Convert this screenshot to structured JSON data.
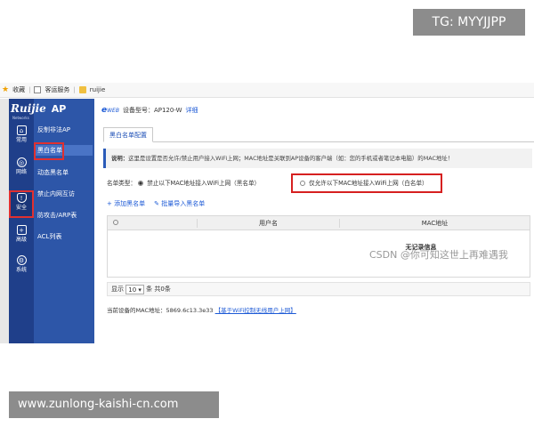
{
  "watermark_top": "TG: MYYJJPP",
  "watermark_bottom": "www.zunlong-kaishi-cn.com",
  "watermark_csdn": "CSDN @你可知这世上再难遇我",
  "browser": {
    "favorites": "收藏",
    "bookmark1": "客运服务",
    "bookmark2": "ruijie"
  },
  "logo": {
    "brand": "Ruijie",
    "product": "AP",
    "sub": "Networks"
  },
  "sidebar": {
    "items": [
      {
        "label": "常用",
        "icon": "home-icon"
      },
      {
        "label": "网络",
        "icon": "globe-icon"
      },
      {
        "label": "安全",
        "icon": "shield-icon"
      },
      {
        "label": "高级",
        "icon": "advanced-icon"
      },
      {
        "label": "系统",
        "icon": "gear-icon"
      }
    ]
  },
  "subnav": {
    "items": [
      {
        "label": "反制非法AP"
      },
      {
        "label": "黑白名单"
      },
      {
        "label": "动态黑名单"
      },
      {
        "label": "禁止内网互访"
      },
      {
        "label": "防攻击/ARP表"
      },
      {
        "label": "ACL列表"
      }
    ]
  },
  "header": {
    "eweb": "e",
    "eweb_suffix": "WEB",
    "model_label": "设备型号：AP120-W",
    "detail": "详细"
  },
  "tabs": {
    "active": "黑白名单配置"
  },
  "note": {
    "label": "说明：",
    "text": "这里是设置是否允许/禁止用户接入WiFi上网；MAC地址是关联到AP设备的客户端（如：您的手机或者笔记本电脑）的MAC地址！"
  },
  "list_type": {
    "label": "名单类型：",
    "option_black": "禁止以下MAC地址接入WiFi上网（黑名单）",
    "option_white": "仅允许以下MAC地址接入WiFi上网（白名单）"
  },
  "actions": {
    "add": "+ 添加黑名单",
    "import": "批量导入黑名单"
  },
  "table": {
    "col_user": "用户名",
    "col_mac": "MAC地址",
    "empty": "无记录信息"
  },
  "pager": {
    "show": "显示",
    "size": "10",
    "total": "条 共0条"
  },
  "mac_line": {
    "text": "当前设备的MAC地址：5869.6c13.3e33",
    "link": "【基于WiFi控制无线用户上网】"
  }
}
